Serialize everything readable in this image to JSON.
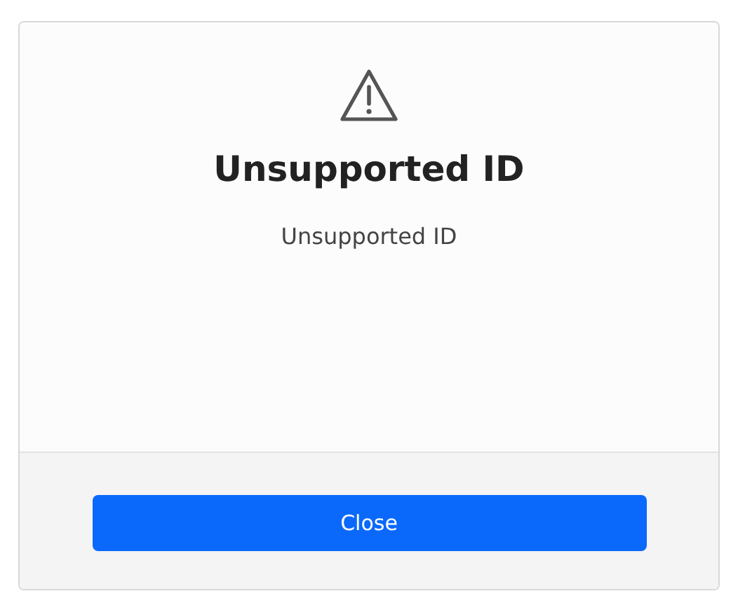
{
  "dialog": {
    "title": "Unsupported ID",
    "message": "Unsupported ID",
    "buttons": [
      {
        "label": "Close",
        "kind": "primary"
      }
    ]
  }
}
